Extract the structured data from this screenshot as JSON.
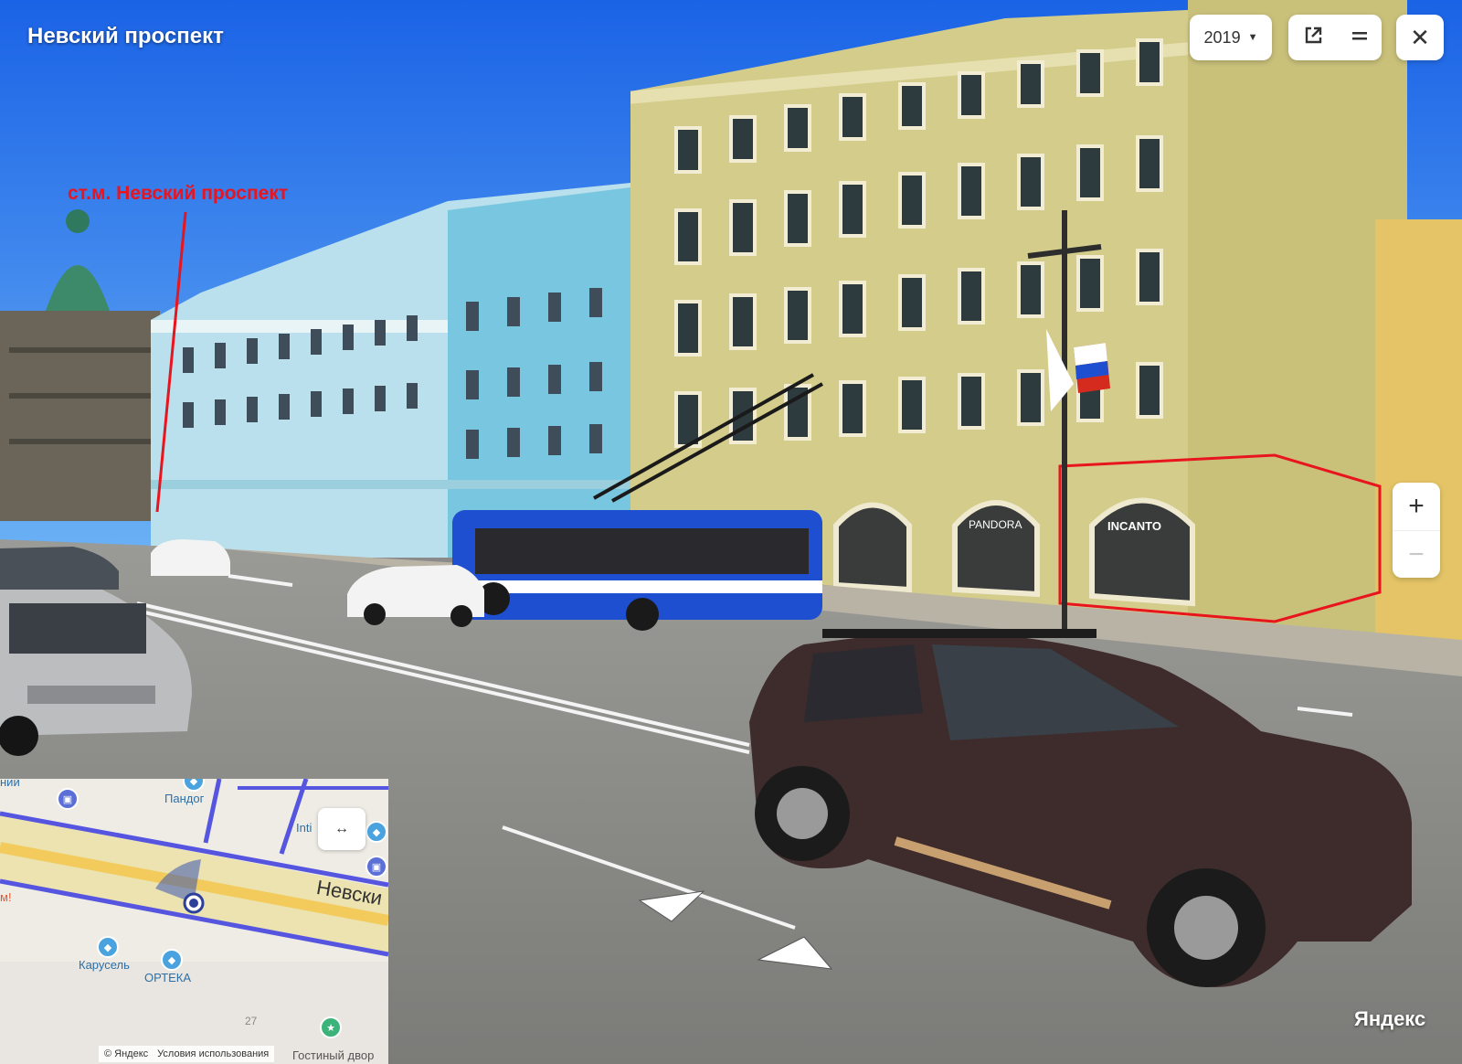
{
  "panorama": {
    "title": "Невский проспект",
    "annotation": "ст.м. Невский проспект",
    "shop_signs": [
      "INCANTO",
      "PANDORA"
    ],
    "logo": "Яндекс"
  },
  "controls": {
    "year_label": "2019",
    "zoom_in": "+",
    "zoom_out": "−",
    "close": "✕",
    "open_external_icon": "external-link-icon",
    "layers_icon": "menu-icon"
  },
  "minimap": {
    "expand_label": "↔",
    "labels": {
      "pandora": "Пандог",
      "intimissimi": "Inti",
      "street": "Невски",
      "carousel": "Карусель",
      "orteka": "ОРТЕКА",
      "house_number": "27",
      "gostiny": "Гостиный двор",
      "left_partial": "ний",
      "left_partial2": "м!"
    },
    "copyright": "© Яндекс",
    "terms": "Условия использования"
  },
  "colors": {
    "sky": "#2f7ff0",
    "yellow_building": "#d6cd8a",
    "blue_building": "#7fc7de",
    "trolleybus": "#1f4fd1",
    "road": "#8b8b88",
    "annotation": "#e8141e"
  }
}
